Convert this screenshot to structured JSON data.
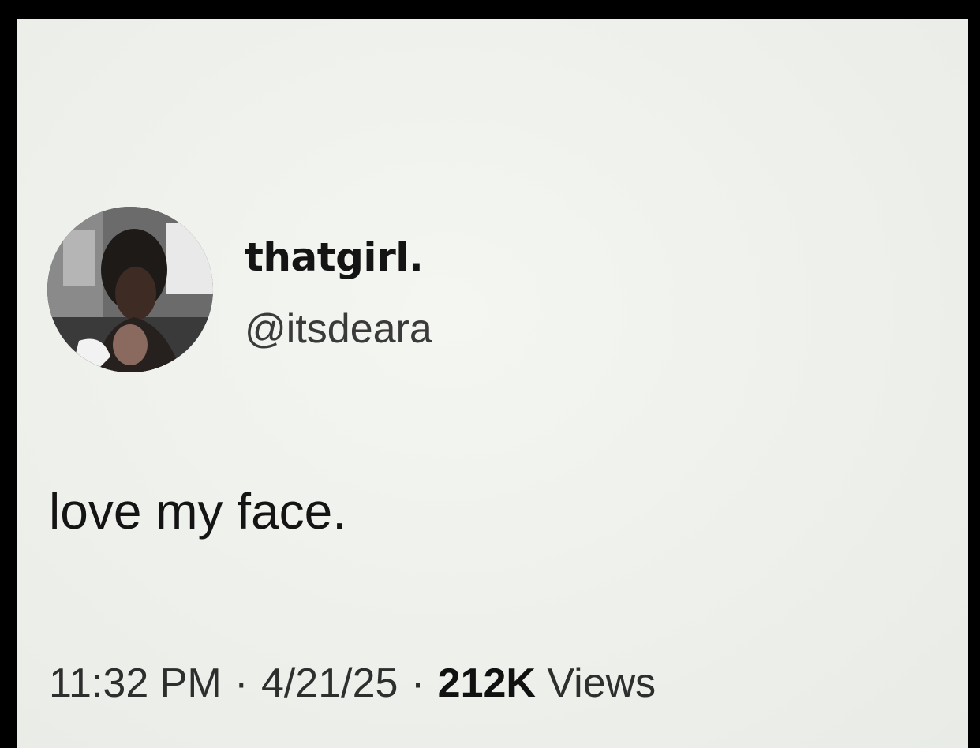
{
  "tweet": {
    "display_name": "thatgirl.",
    "handle": "@itsdeara",
    "text": "love my face.",
    "time": "11:32 PM",
    "separator": " · ",
    "date": "4/21/25",
    "views_count": "212K",
    "views_label": " Views"
  },
  "colors": {
    "background": "#eef0ec",
    "frame": "#000000",
    "text_primary": "#141414",
    "text_secondary": "#2e2e2e"
  },
  "icons": {
    "avatar": "profile-photo"
  }
}
